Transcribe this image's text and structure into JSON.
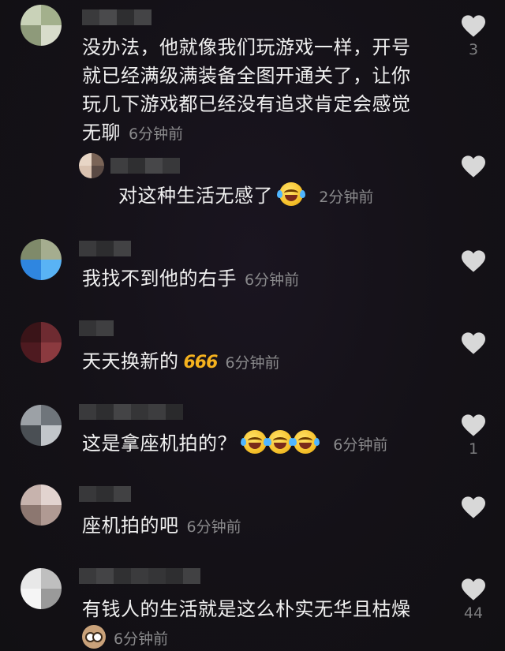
{
  "comments": [
    {
      "text": "没办法，他就像我们玩游戏一样，开号就已经满级满装备全图开通关了，让你玩几下游戏都已经没有追求肯定会感觉无聊",
      "time": "6分钟前",
      "likes": "3",
      "avatar_colors": [
        "#c9d2b8",
        "#a3b08c",
        "#8e9a7a",
        "#d8dccb"
      ]
    },
    {
      "text": "对这种生活无感了",
      "emoji": [
        "rofl-emoji"
      ],
      "time": "2分钟前",
      "likes": "",
      "reply": true,
      "avatar_colors": [
        "#e8d6c6",
        "#7a6457",
        "#d9c2b0",
        "#5a4a44"
      ]
    },
    {
      "text": "我找不到他的右手",
      "time": "6分钟前",
      "likes": "",
      "avatar_colors": [
        "#7f8a6a",
        "#a5ad8f",
        "#2f86e0",
        "#59b3f5"
      ]
    },
    {
      "text": "天天换新的",
      "badge": "666",
      "time": "6分钟前",
      "likes": "",
      "avatar_colors": [
        "#3a1418",
        "#6e2b31",
        "#4e1a20",
        "#8b3a3f"
      ]
    },
    {
      "text": "这是拿座机拍的？",
      "emoji": [
        "rofl-emoji",
        "rofl-emoji",
        "rofl-emoji"
      ],
      "time": "6分钟前",
      "likes": "1",
      "avatar_colors": [
        "#9ca1a6",
        "#6f757b",
        "#4a4f54",
        "#c2c6ca"
      ]
    },
    {
      "text": "座机拍的吧",
      "time": "6分钟前",
      "likes": "",
      "avatar_colors": [
        "#c7b3ad",
        "#e2d3cf",
        "#8c7770",
        "#b09a93"
      ]
    },
    {
      "text": "有钱人的生活就是这么朴实无华且枯燥",
      "emoji_after": "owl-emoji",
      "time": "6分钟前",
      "likes": "44",
      "avatar_colors": [
        "#e8e8e8",
        "#bfbfbf",
        "#f5f5f5",
        "#9a9a9a"
      ]
    }
  ],
  "icons": {
    "like": "heart-icon"
  },
  "colors": {
    "text": "#f0f0f0",
    "meta": "#8a8a8c",
    "heart": "#d8d8d8",
    "badge_666": "#f5b21e"
  }
}
